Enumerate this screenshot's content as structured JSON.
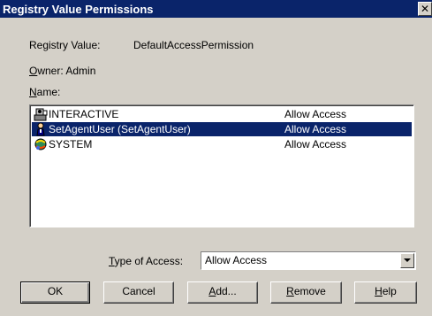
{
  "window": {
    "title": "Registry Value Permissions",
    "close_label": "✕"
  },
  "info": {
    "registry_value_label": "Registry Value:",
    "registry_value": "DefaultAccessPermission",
    "owner_label_prefix": "O",
    "owner_label_rest": "wner: Admin",
    "name_label_prefix": "N",
    "name_label_rest": "ame:"
  },
  "list": {
    "rows": [
      {
        "name": "INTERACTIVE",
        "access": "Allow Access",
        "icon": "group-icon",
        "selected": false
      },
      {
        "name": "SetAgentUser (SetAgentUser)",
        "access": "Allow Access",
        "icon": "user-icon",
        "selected": true
      },
      {
        "name": "SYSTEM",
        "access": "Allow Access",
        "icon": "system-icon",
        "selected": false
      }
    ]
  },
  "access": {
    "label_prefix": "T",
    "label_rest": "ype of Access:",
    "selected": "Allow Access"
  },
  "buttons": {
    "ok": "OK",
    "cancel": "Cancel",
    "add_prefix": "A",
    "add_rest": "dd...",
    "remove_prefix": "R",
    "remove_rest": "emove",
    "help_prefix": "H",
    "help_rest": "elp"
  },
  "colors": {
    "title_bg": "#0a246a",
    "dialog_bg": "#d4d0c8",
    "selection": "#0a246a"
  }
}
